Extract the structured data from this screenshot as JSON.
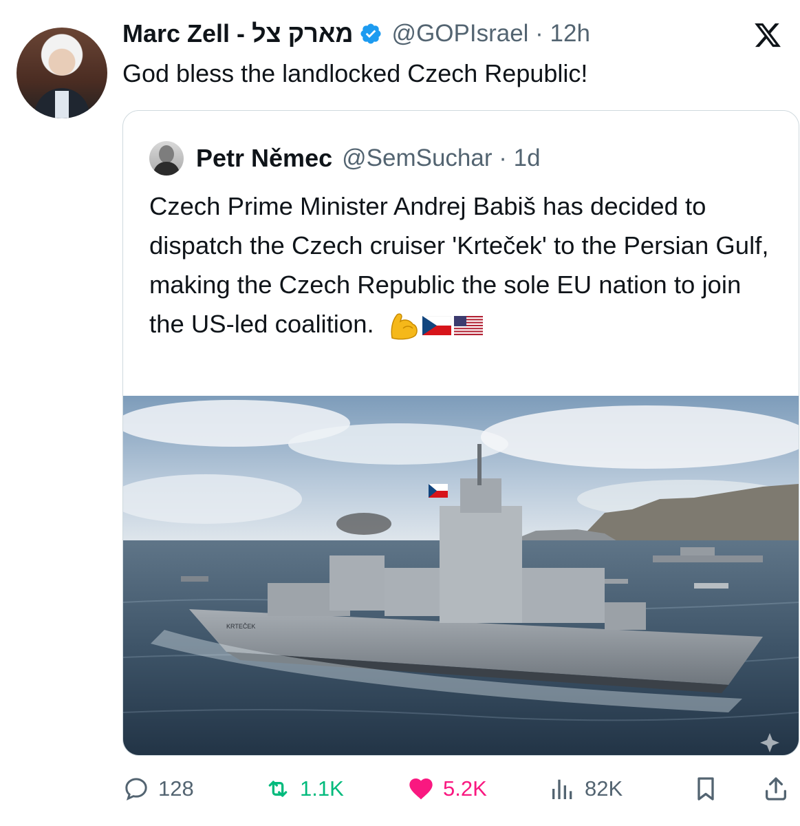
{
  "tweet": {
    "author_name": "Marc Zell - מארק צל",
    "handle_time": "@GOPIsrael · 12h",
    "text": "God bless the landlocked Czech Republic!"
  },
  "quote": {
    "author_name": "Petr Němec",
    "handle_time": "@SemSuchar · 1d",
    "text": "Czech Prime Minister Andrej Babiš has decided to dispatch the Czech cruiser 'Krteček' to the Persian Gulf, making the Czech Republic the sole EU nation to join the US-led coalition.",
    "emojis": [
      "flexed-biceps",
      "czech-flag",
      "us-flag"
    ],
    "image": {
      "description_icons": [
        "warship",
        "sea",
        "mountains",
        "czech-flag"
      ],
      "hull_marking": "KRTEČEK"
    }
  },
  "actions": {
    "replies": "128",
    "reposts": "1.1K",
    "likes": "5.2K",
    "views": "82K"
  },
  "colors": {
    "text": "#0f1419",
    "secondary": "#536471",
    "verified": "#1d9bf0",
    "repost": "#00ba7c",
    "like": "#f91880",
    "border": "#cfd9de"
  }
}
